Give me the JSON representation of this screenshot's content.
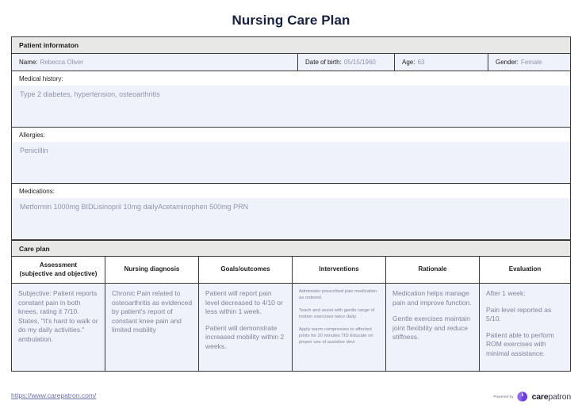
{
  "document": {
    "title": "Nursing Care Plan"
  },
  "patient_information": {
    "section_label": "Patient informaton",
    "fields": [
      {
        "label": "Name:",
        "value": "Rebecca Oliver"
      },
      {
        "label": "Date of birth:",
        "value": "05/15/1960"
      },
      {
        "label": "Age:",
        "value": "63"
      },
      {
        "label": "Gender:",
        "value": "Female"
      }
    ]
  },
  "medical_history": {
    "label": "Medical history:",
    "value": "Type 2 diabetes, hypertension, osteoarthritis"
  },
  "allergies": {
    "label": "Allergies:",
    "value": "Penicillin"
  },
  "medications": {
    "label": "Medications:",
    "value": "Metformin 1000mg BIDLisinopril 10mg dailyAcetaminophen 500mg PRN"
  },
  "care_plan": {
    "section_label": "Care plan",
    "columns": [
      "Assessment (subjective and objective)",
      "Nursing diagnosis",
      "Goals/outcomes",
      "Interventions",
      "Rationale",
      "Evaluation"
    ],
    "column_headers": {
      "assessment_line1": "Assessment",
      "assessment_line2": "(subjective and objective)",
      "nursing_diagnosis": "Nursing diagnosis",
      "goals_outcomes": "Goals/outcomes",
      "interventions": "Interventions",
      "rationale": "Rationale",
      "evaluation": "Evaluation"
    },
    "row": {
      "assessment": [
        "Subjective: Patient reports constant pain in both knees, rating it 7/10. States, \"It's hard to walk or do my daily activities.\" ambulation."
      ],
      "nursing_diagnosis": [
        "Chronic Pain related to osteoarthritis as evidenced by patient's report of constant knee pain and limited mobility"
      ],
      "goals_outcomes": [
        "Patient will report pain level decreased to 4/10 or less within 1 week.",
        "Patient will demonstrate increased mobility within 2 weeks."
      ],
      "interventions": [
        "Administer prescribed pain medication as ordered.",
        "Teach and assist with gentle range of motion exercises twice daily.",
        "Apply warm compresses to affected joints for 20 minutes TID Educate on proper use of assistive devi"
      ],
      "rationale": [
        "Medication helps manage pain and improve function.",
        "Gentle exercises maintain joint flexibility and reduce stiffness."
      ],
      "evaluation": [
        "After 1 week:",
        "Pain level reported as 5/10.",
        "Patient able to perform ROM exercises with minimal assistance."
      ]
    }
  },
  "footer": {
    "url": "https://www.carepatron.com/",
    "powered_by": "Powered by",
    "brand_bold": "care",
    "brand_light": "patron"
  },
  "colors": {
    "title": "#17203f",
    "section_header_bg": "#e8e8e6",
    "value_bg": "#f0f2fb",
    "value_text": "#8e94ae",
    "border": "#3a3a3a",
    "brand_purple": "#7b4ce0",
    "link": "#6b6fa8"
  }
}
